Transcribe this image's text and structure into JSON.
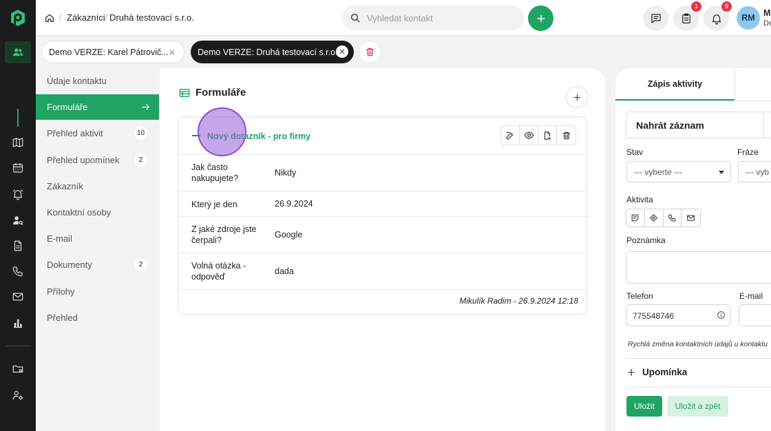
{
  "breadcrumb": {
    "items": [
      "Zákazníci",
      "Druhá testovací s.r.o."
    ]
  },
  "search": {
    "placeholder": "Vyhledat kontakt"
  },
  "header": {
    "badges": {
      "tasks": "1",
      "notifications": "9"
    },
    "user": {
      "initials": "RM",
      "name": "M",
      "sub": "De"
    }
  },
  "tabs": [
    {
      "label": "Demo VERZE: Karel Pátrovič..."
    },
    {
      "label": "Demo VERZE: Druhá testovací s.r.o."
    }
  ],
  "menu": {
    "items": [
      {
        "label": "Údaje kontaktu"
      },
      {
        "label": "Formuláře"
      },
      {
        "label": "Přehled aktivit",
        "count": "10"
      },
      {
        "label": "Přehled upomínek",
        "count": "2"
      },
      {
        "label": "Zákazník"
      },
      {
        "label": "Kontaktní osoby"
      },
      {
        "label": "E-mail"
      },
      {
        "label": "Dokumenty",
        "count": "2"
      },
      {
        "label": "Přílohy"
      },
      {
        "label": "Přehled"
      }
    ]
  },
  "main": {
    "title": "Formuláře",
    "form": {
      "name": "Nový dotazník - pro firmy",
      "rows": [
        {
          "q": "Jak často nakupujete?",
          "a": "Nikdy"
        },
        {
          "q": "Který je den",
          "a": "26.9.2024"
        },
        {
          "q": "Z jaké zdroje jste čerpali?",
          "a": "Google"
        },
        {
          "q": "Volná otázka - odpověď",
          "a": "dada"
        }
      ],
      "signature": "Mikulík Radim - 26.9.2024 12:18"
    }
  },
  "right": {
    "tab": "Zápis aktivity",
    "upload": "Nahrát záznam",
    "state_label": "Stav",
    "state_value": "--- vyberte ---",
    "phrase_label": "Fráze",
    "phrase_value": "--- vyb",
    "activity_label": "Aktivita",
    "note_label": "Poznámka",
    "phone_label": "Telefon",
    "phone_value": "775548746",
    "email_label": "E-mail",
    "quick_change": "Rychlá změna kontaktních údajů u kontaktu",
    "reminder": "Upomínka",
    "save": "Uložit",
    "save_back": "Uložit a zpět"
  },
  "colors": {
    "accent": "#1fa463",
    "dark": "#1c1c1c",
    "badge": "#e4354b"
  }
}
